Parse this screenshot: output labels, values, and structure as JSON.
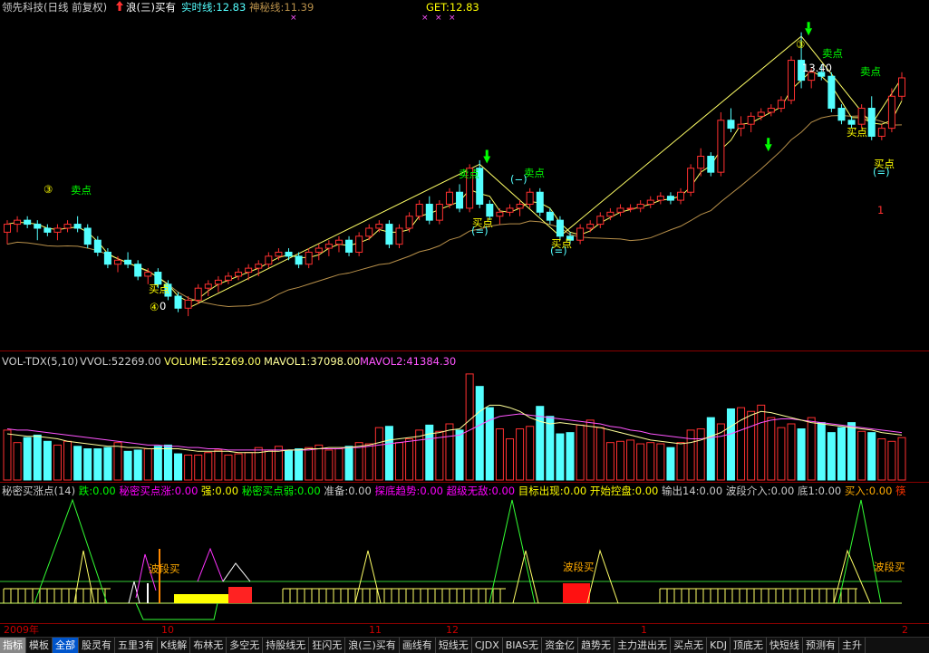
{
  "header": {
    "stock": "领先科技(日线 前复权)",
    "arrow_icon": "red-up-arrow-icon",
    "wave": "浪(三)买有",
    "realtime_label": "实时线:12.83",
    "mystic_label": "神秘线:11.39",
    "get_label": "GET:12.83"
  },
  "main_annotations": {
    "sell": "卖点",
    "buy": "买点",
    "circle3": "③",
    "circle4": "④",
    "circle_dash": "(−)",
    "circle_eq": "(=)",
    "high_label": "13.40",
    "low_label": "0",
    "red_one": "1"
  },
  "vol_header": {
    "name": "VOL-TDX(5,10)",
    "vvol": "VVOL:52269.00",
    "volume": "VOLUME:52269.00",
    "mavol1": "MAVOL1:37098.00",
    "mavol2": "MAVOL2:41384.30"
  },
  "ind_header": {
    "items": [
      {
        "text": "秘密买涨点(14)",
        "color": "#cccccc"
      },
      {
        "text": "跌:0.00",
        "color": "#00ff00"
      },
      {
        "text": "秘密买点涨:0.00",
        "color": "#ff00ff"
      },
      {
        "text": "强:0.00",
        "color": "#ffff00"
      },
      {
        "text": "秘密买点弱:0.00",
        "color": "#00ff00"
      },
      {
        "text": "准备:0.00",
        "color": "#cccccc"
      },
      {
        "text": "探底趋势:0.00",
        "color": "#ff00ff"
      },
      {
        "text": "超级无敌:0.00",
        "color": "#ff00ff"
      },
      {
        "text": "目标出现:0.00",
        "color": "#ffff00"
      },
      {
        "text": "开始控盘:0.00",
        "color": "#ffff00"
      },
      {
        "text": "输出14:0.00",
        "color": "#cccccc"
      },
      {
        "text": "波段介入:0.00",
        "color": "#cccccc"
      },
      {
        "text": "底1:0.00",
        "color": "#cccccc"
      },
      {
        "text": "买入:0.00",
        "color": "#ffaa00"
      },
      {
        "text": "筷",
        "color": "#ff3300"
      }
    ],
    "wave_buy": "波段买"
  },
  "date_bar": [
    "2009年",
    "10",
    "11",
    "12",
    "1",
    "2"
  ],
  "tabs": [
    "指标",
    "模板",
    "全部",
    "股灵有",
    "五里3有",
    "K线解",
    "布林无",
    "多空无",
    "持股线无",
    "狂闪无",
    "浪(三)买有",
    "画线有",
    "短线无",
    "CJDX",
    "BIAS无",
    "资金亿",
    "趋势无",
    "主力进出无",
    "买点无",
    "KDJ",
    "顶底无",
    "快短线",
    "预测有",
    "主升"
  ],
  "colors": {
    "up": "#ff3030",
    "down": "#54ffff",
    "ma_yellow": "#ffff66",
    "ma_tan": "#b8904a",
    "mavol1": "#ffff99",
    "mavol2": "#ff55ff",
    "sell_text": "#00ff00",
    "buy_text": "#ffff00"
  },
  "chart_data": [
    {
      "type": "candlestick",
      "title": "领先科技(日线 前复权)",
      "price_range": [
        9.5,
        13.6
      ],
      "candles": [
        [
          10.9,
          11.05,
          10.75,
          11.0
        ],
        [
          11.0,
          11.1,
          10.9,
          11.05
        ],
        [
          11.05,
          11.1,
          10.95,
          11.0
        ],
        [
          11.0,
          11.05,
          10.8,
          10.95
        ],
        [
          10.95,
          11.0,
          10.85,
          10.9
        ],
        [
          10.9,
          11.0,
          10.8,
          10.95
        ],
        [
          10.95,
          11.05,
          10.9,
          11.0
        ],
        [
          11.0,
          11.1,
          10.9,
          10.95
        ],
        [
          10.95,
          11.0,
          10.7,
          10.75
        ],
        [
          10.8,
          10.85,
          10.6,
          10.65
        ],
        [
          10.65,
          10.7,
          10.45,
          10.5
        ],
        [
          10.5,
          10.6,
          10.4,
          10.55
        ],
        [
          10.55,
          10.65,
          10.45,
          10.5
        ],
        [
          10.5,
          10.55,
          10.3,
          10.35
        ],
        [
          10.35,
          10.45,
          10.25,
          10.4
        ],
        [
          10.4,
          10.45,
          10.2,
          10.25
        ],
        [
          10.25,
          10.3,
          10.05,
          10.1
        ],
        [
          10.1,
          10.15,
          9.9,
          9.95
        ],
        [
          9.95,
          10.1,
          9.85,
          10.05
        ],
        [
          10.05,
          10.25,
          10.0,
          10.2
        ],
        [
          10.2,
          10.3,
          10.1,
          10.25
        ],
        [
          10.25,
          10.35,
          10.15,
          10.3
        ],
        [
          10.3,
          10.4,
          10.25,
          10.35
        ],
        [
          10.35,
          10.45,
          10.3,
          10.4
        ],
        [
          10.4,
          10.5,
          10.3,
          10.45
        ],
        [
          10.45,
          10.55,
          10.35,
          10.5
        ],
        [
          10.5,
          10.65,
          10.45,
          10.6
        ],
        [
          10.6,
          10.7,
          10.55,
          10.65
        ],
        [
          10.65,
          10.7,
          10.55,
          10.6
        ],
        [
          10.6,
          10.65,
          10.45,
          10.5
        ],
        [
          10.5,
          10.7,
          10.45,
          10.65
        ],
        [
          10.65,
          10.75,
          10.55,
          10.7
        ],
        [
          10.7,
          10.8,
          10.6,
          10.75
        ],
        [
          10.75,
          10.85,
          10.65,
          10.8
        ],
        [
          10.8,
          10.85,
          10.6,
          10.65
        ],
        [
          10.65,
          10.9,
          10.6,
          10.85
        ],
        [
          10.85,
          11.0,
          10.8,
          10.95
        ],
        [
          10.95,
          11.05,
          10.9,
          11.0
        ],
        [
          11.0,
          11.05,
          10.7,
          10.75
        ],
        [
          10.75,
          11.0,
          10.7,
          10.95
        ],
        [
          10.95,
          11.15,
          10.9,
          11.1
        ],
        [
          11.1,
          11.3,
          11.05,
          11.25
        ],
        [
          11.25,
          11.35,
          11.0,
          11.05
        ],
        [
          11.05,
          11.3,
          11.0,
          11.25
        ],
        [
          11.25,
          11.45,
          11.2,
          11.4
        ],
        [
          11.4,
          11.5,
          11.15,
          11.2
        ],
        [
          11.2,
          11.75,
          11.15,
          11.7
        ],
        [
          11.7,
          11.8,
          11.2,
          11.25
        ],
        [
          11.25,
          11.3,
          11.05,
          11.1
        ],
        [
          11.1,
          11.2,
          11.0,
          11.15
        ],
        [
          11.15,
          11.25,
          11.1,
          11.2
        ],
        [
          11.2,
          11.3,
          11.1,
          11.25
        ],
        [
          11.25,
          11.45,
          11.2,
          11.4
        ],
        [
          11.4,
          11.45,
          11.1,
          11.15
        ],
        [
          11.15,
          11.2,
          11.0,
          11.05
        ],
        [
          11.05,
          11.1,
          10.8,
          10.85
        ],
        [
          10.85,
          10.9,
          10.75,
          10.8
        ],
        [
          10.8,
          11.0,
          10.75,
          10.95
        ],
        [
          10.95,
          11.05,
          10.9,
          11.0
        ],
        [
          11.0,
          11.15,
          10.95,
          11.1
        ],
        [
          11.1,
          11.2,
          11.05,
          11.15
        ],
        [
          11.15,
          11.25,
          11.1,
          11.2
        ],
        [
          11.2,
          11.25,
          11.15,
          11.2
        ],
        [
          11.2,
          11.3,
          11.15,
          11.25
        ],
        [
          11.25,
          11.35,
          11.2,
          11.3
        ],
        [
          11.3,
          11.4,
          11.25,
          11.35
        ],
        [
          11.35,
          11.4,
          11.25,
          11.3
        ],
        [
          11.3,
          11.45,
          11.25,
          11.4
        ],
        [
          11.4,
          11.75,
          11.35,
          11.7
        ],
        [
          11.7,
          11.95,
          11.6,
          11.85
        ],
        [
          11.85,
          11.9,
          11.6,
          11.65
        ],
        [
          11.65,
          12.4,
          11.6,
          12.3
        ],
        [
          12.3,
          12.45,
          12.15,
          12.2
        ],
        [
          12.2,
          12.35,
          12.1,
          12.25
        ],
        [
          12.25,
          12.4,
          12.15,
          12.35
        ],
        [
          12.35,
          12.45,
          12.3,
          12.4
        ],
        [
          12.4,
          12.5,
          12.35,
          12.45
        ],
        [
          12.45,
          12.6,
          12.4,
          12.55
        ],
        [
          12.55,
          13.1,
          12.5,
          13.05
        ],
        [
          13.05,
          13.4,
          12.7,
          12.8
        ],
        [
          12.8,
          12.95,
          12.7,
          12.9
        ],
        [
          12.9,
          13.0,
          12.8,
          12.85
        ],
        [
          12.85,
          12.9,
          12.4,
          12.45
        ],
        [
          12.45,
          12.5,
          12.25,
          12.3
        ],
        [
          12.3,
          12.35,
          12.2,
          12.25
        ],
        [
          12.25,
          12.5,
          12.2,
          12.45
        ],
        [
          12.45,
          12.6,
          12.05,
          12.1
        ],
        [
          12.1,
          12.25,
          12.05,
          12.2
        ],
        [
          12.2,
          12.7,
          12.15,
          12.6
        ],
        [
          12.6,
          12.9,
          12.55,
          12.83
        ]
      ]
    },
    {
      "type": "bar",
      "title": "VOL-TDX(5,10)",
      "series": [
        {
          "name": "VOLUME",
          "values": [
            40,
            30,
            34,
            36,
            31,
            28,
            31,
            27,
            25,
            25,
            26,
            30,
            23,
            24,
            25,
            27,
            28,
            21,
            20,
            20,
            22,
            24,
            20,
            21,
            22,
            26,
            24,
            27,
            24,
            25,
            26,
            28,
            24,
            25,
            27,
            30,
            29,
            42,
            43,
            30,
            33,
            40,
            44,
            39,
            45,
            40,
            85,
            75,
            58,
            41,
            33,
            41,
            43,
            59,
            51,
            37,
            38,
            44,
            48,
            42,
            30,
            31,
            32,
            29,
            30,
            29,
            26,
            30,
            40,
            41,
            50,
            45,
            57,
            58,
            55,
            60,
            50,
            42,
            45,
            41,
            50,
            46,
            38,
            42,
            46,
            39,
            38,
            33,
            31,
            34
          ]
        },
        {
          "name": "MAVOL1",
          "values": [
            37,
            36,
            35,
            35,
            34,
            33,
            31,
            30,
            29,
            28,
            27,
            27,
            26,
            26,
            25,
            25,
            25,
            25,
            24,
            23,
            23,
            23,
            23,
            22,
            22,
            22,
            23,
            23,
            24,
            24,
            25,
            25,
            26,
            26,
            26,
            27,
            28,
            30,
            32,
            33,
            34,
            35,
            37,
            38,
            40,
            41,
            48,
            55,
            60,
            60,
            58,
            55,
            50,
            47,
            45,
            46,
            45,
            44,
            43,
            42,
            40,
            38,
            36,
            34,
            32,
            31,
            30,
            29,
            30,
            32,
            35,
            38,
            43,
            48,
            52,
            55,
            54,
            52,
            50,
            48,
            46,
            45,
            44,
            43,
            42,
            41,
            40,
            38,
            37,
            36
          ]
        },
        {
          "name": "MAVOL2",
          "values": [
            41,
            40,
            40,
            39,
            38,
            37,
            36,
            35,
            34,
            33,
            32,
            31,
            30,
            29,
            28,
            28,
            27,
            27,
            26,
            26,
            25,
            25,
            24,
            24,
            24,
            24,
            24,
            24,
            24,
            24,
            24,
            25,
            25,
            25,
            26,
            26,
            27,
            28,
            29,
            30,
            31,
            32,
            33,
            34,
            35,
            36,
            40,
            44,
            48,
            51,
            52,
            53,
            52,
            51,
            50,
            49,
            48,
            47,
            46,
            45,
            43,
            42,
            40,
            39,
            37,
            36,
            35,
            34,
            33,
            33,
            34,
            35,
            37,
            40,
            43,
            46,
            48,
            49,
            49,
            48,
            47,
            46,
            45,
            44,
            43,
            42,
            41,
            40,
            39,
            38
          ]
        }
      ]
    }
  ]
}
